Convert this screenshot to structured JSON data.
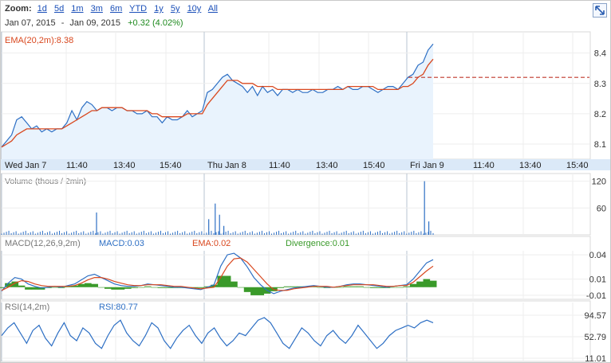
{
  "zoom": {
    "label": "Zoom:",
    "options": [
      "1d",
      "5d",
      "1m",
      "3m",
      "6m",
      "YTD",
      "1y",
      "5y",
      "10y",
      "All"
    ]
  },
  "range": {
    "start": "Jan 07, 2015",
    "sep": "-",
    "end": "Jan 09, 2015",
    "change": "+0.32 (4.02%)"
  },
  "colors": {
    "price": "#2d6fc4",
    "ema": "#d9481f",
    "fill": "#e9f3fd",
    "divergence": "#3a9a2a",
    "last_price": "#c0392b",
    "axis_band": "#dbe9f8",
    "change": "#1e8a1e",
    "link": "#1a4fb8"
  },
  "icons": {
    "expand": "expand-diagonal-arrows-icon"
  },
  "chart_data": [
    {
      "type": "line",
      "panel": "price",
      "indicator_label": "EMA(20,2m):8.38",
      "last_price": 8.32,
      "y_ticks": [
        "8.1",
        "8.2",
        "8.3",
        "8.4"
      ],
      "ylim": [
        8.05,
        8.47
      ],
      "x_labels": [
        "Wed Jan 7",
        "11:40",
        "13:40",
        "15:40",
        "Thu Jan 8",
        "11:40",
        "13:40",
        "15:40",
        "Fri Jan 9",
        "11:40",
        "13:40",
        "15:40"
      ],
      "series": [
        {
          "values": [
            8.09,
            8.11,
            8.13,
            8.18,
            8.19,
            8.17,
            8.15,
            8.16,
            8.14,
            8.15,
            8.14,
            8.15,
            8.15,
            8.17,
            8.21,
            8.18,
            8.22,
            8.24,
            8.23,
            8.21,
            8.22,
            8.22,
            8.21,
            8.22,
            8.22,
            8.21,
            8.21,
            8.2,
            8.2,
            8.21,
            8.19,
            8.19,
            8.17,
            8.19,
            8.18,
            8.18,
            8.19,
            8.21,
            8.19,
            8.2,
            8.21,
            8.27,
            8.28,
            8.3,
            8.32,
            8.33,
            8.31,
            8.3,
            8.29,
            8.27,
            8.29,
            8.26,
            8.29,
            8.27,
            8.28,
            8.26,
            8.28,
            8.28,
            8.27,
            8.28,
            8.27,
            8.27,
            8.28,
            8.27,
            8.27,
            8.28,
            8.28,
            8.29,
            8.28,
            8.29,
            8.28,
            8.28,
            8.29,
            8.29,
            8.28,
            8.27,
            8.28,
            8.29,
            8.29,
            8.28,
            8.3,
            8.32,
            8.33,
            8.36,
            8.37,
            8.41,
            8.43
          ]
        },
        {
          "values": [
            8.09,
            8.1,
            8.11,
            8.13,
            8.14,
            8.15,
            8.15,
            8.15,
            8.15,
            8.15,
            8.15,
            8.15,
            8.15,
            8.16,
            8.17,
            8.18,
            8.19,
            8.2,
            8.21,
            8.21,
            8.22,
            8.22,
            8.22,
            8.22,
            8.22,
            8.21,
            8.21,
            8.21,
            8.21,
            8.21,
            8.2,
            8.2,
            8.19,
            8.19,
            8.19,
            8.19,
            8.19,
            8.2,
            8.2,
            8.2,
            8.2,
            8.23,
            8.25,
            8.27,
            8.29,
            8.31,
            8.31,
            8.31,
            8.3,
            8.3,
            8.3,
            8.29,
            8.29,
            8.29,
            8.29,
            8.28,
            8.28,
            8.28,
            8.28,
            8.28,
            8.28,
            8.28,
            8.28,
            8.28,
            8.28,
            8.28,
            8.28,
            8.28,
            8.28,
            8.29,
            8.29,
            8.29,
            8.29,
            8.29,
            8.29,
            8.28,
            8.28,
            8.28,
            8.28,
            8.28,
            8.29,
            8.29,
            8.3,
            8.32,
            8.33,
            8.36,
            8.38
          ]
        }
      ]
    },
    {
      "type": "bar",
      "panel": "volume",
      "label": "Volume (thous / 2min)",
      "y_ticks": [
        "120",
        "60"
      ],
      "ylim": [
        0,
        130
      ],
      "spikes": [
        {
          "x": 0.22,
          "value": 50
        },
        {
          "x": 0.48,
          "value": 35
        },
        {
          "x": 0.495,
          "value": 70
        },
        {
          "x": 0.505,
          "value": 45
        },
        {
          "x": 0.515,
          "value": 20
        },
        {
          "x": 0.98,
          "value": 120
        },
        {
          "x": 0.99,
          "value": 30
        }
      ]
    },
    {
      "type": "line",
      "panel": "macd",
      "label": "MACD(12,26,9,2m)",
      "macd_label": "MACD:0.03",
      "ema_label": "EMA:0.02",
      "divergence_label": "Divergence:0.01",
      "y_ticks": [
        "0.04",
        "0.01",
        "-0.01"
      ],
      "ylim": [
        -0.015,
        0.045
      ],
      "series": [
        {
          "values": [
            -0.005,
            0.005,
            0.012,
            0.01,
            0.004,
            0.001,
            -0.001,
            0.0,
            0.001,
            0.0,
            0.002,
            0.004,
            0.009,
            0.014,
            0.016,
            0.012,
            0.008,
            0.004,
            0.002,
            0.001,
            0.001,
            0.002,
            0.004,
            0.003,
            0.002,
            0.001,
            0.0,
            0.0,
            -0.001,
            -0.002,
            -0.003,
            0.0,
            0.003,
            0.026,
            0.04,
            0.042,
            0.036,
            0.025,
            0.012,
            0.003,
            -0.004,
            -0.008,
            -0.005,
            -0.003,
            -0.001,
            0.0,
            0.001,
            0.002,
            0.001,
            0.0,
            0.0,
            0.001,
            0.003,
            0.004,
            0.004,
            0.003,
            0.002,
            0.001,
            0.0,
            0.001,
            0.002,
            0.003,
            0.01,
            0.02,
            0.03,
            0.034
          ]
        },
        {
          "values": [
            -0.004,
            0.0,
            0.005,
            0.008,
            0.007,
            0.004,
            0.002,
            0.001,
            0.001,
            0.001,
            0.001,
            0.002,
            0.005,
            0.009,
            0.012,
            0.012,
            0.01,
            0.007,
            0.005,
            0.003,
            0.002,
            0.002,
            0.003,
            0.003,
            0.003,
            0.002,
            0.001,
            0.001,
            0.0,
            -0.001,
            -0.002,
            -0.001,
            0.0,
            0.012,
            0.026,
            0.035,
            0.036,
            0.031,
            0.022,
            0.013,
            0.004,
            -0.003,
            -0.004,
            -0.004,
            -0.002,
            -0.001,
            0.0,
            0.001,
            0.001,
            0.001,
            0.0,
            0.001,
            0.002,
            0.003,
            0.003,
            0.003,
            0.003,
            0.002,
            0.001,
            0.001,
            0.002,
            0.002,
            0.006,
            0.013,
            0.02,
            0.026
          ]
        },
        {
          "values": [
            -0.001,
            0.005,
            0.007,
            0.002,
            -0.003,
            -0.003,
            -0.003,
            -0.001,
            0.0,
            -0.001,
            0.001,
            0.002,
            0.004,
            0.005,
            0.004,
            0.0,
            -0.002,
            -0.003,
            -0.003,
            -0.002,
            -0.001,
            0.0,
            0.001,
            0.0,
            -0.001,
            -0.001,
            -0.001,
            -0.001,
            -0.001,
            -0.001,
            -0.001,
            0.001,
            0.003,
            0.014,
            0.014,
            0.007,
            0.0,
            -0.006,
            -0.01,
            -0.01,
            -0.008,
            -0.005,
            -0.001,
            0.001,
            0.001,
            0.001,
            0.001,
            0.001,
            0.0,
            -0.001,
            0.0,
            0.0,
            0.001,
            0.001,
            0.001,
            0.0,
            -0.001,
            -0.001,
            -0.001,
            0.0,
            0.0,
            0.001,
            0.004,
            0.007,
            0.01,
            0.008
          ]
        }
      ]
    },
    {
      "type": "line",
      "panel": "rsi",
      "label": "RSI(14,2m)",
      "rsi_label": "RSI:80.77",
      "y_ticks": [
        "94.57",
        "52.79",
        "11.01"
      ],
      "ylim": [
        11.01,
        94.57
      ],
      "series": [
        {
          "values": [
            55,
            70,
            80,
            60,
            40,
            65,
            75,
            50,
            35,
            60,
            80,
            55,
            45,
            70,
            60,
            40,
            30,
            55,
            75,
            85,
            60,
            45,
            35,
            55,
            80,
            70,
            45,
            30,
            50,
            65,
            75,
            55,
            40,
            60,
            70,
            50,
            35,
            45,
            60,
            55,
            70,
            85,
            90,
            80,
            60,
            40,
            30,
            50,
            70,
            60,
            45,
            35,
            55,
            65,
            50,
            40,
            55,
            75,
            60,
            45,
            30,
            40,
            55,
            65,
            70,
            75,
            70,
            80,
            85,
            80
          ]
        }
      ]
    }
  ]
}
